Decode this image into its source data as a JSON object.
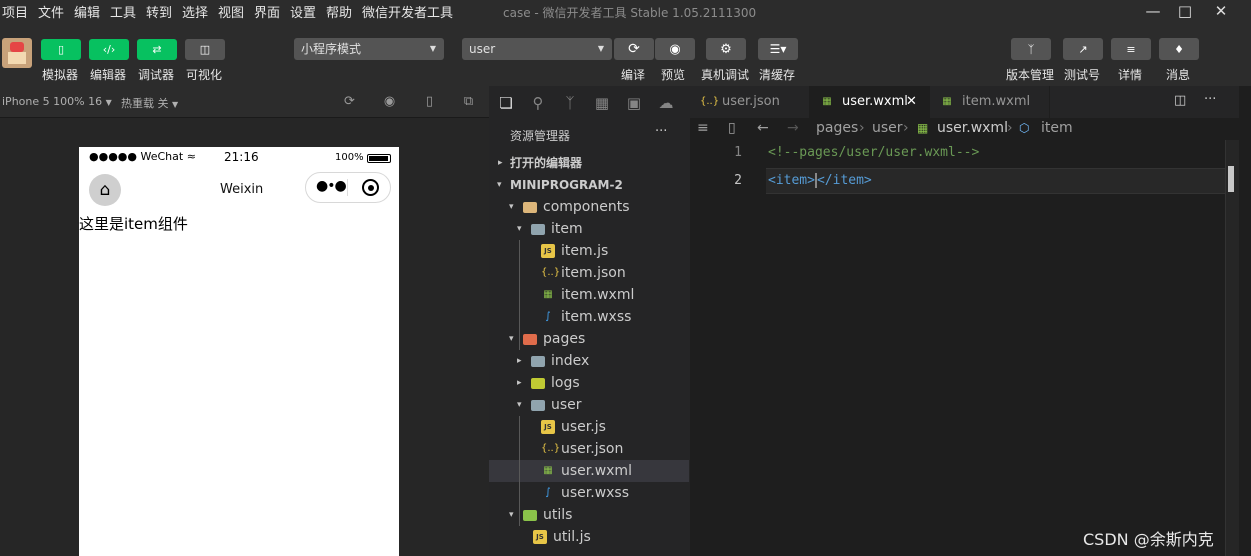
{
  "menu": [
    "项目",
    "文件",
    "编辑",
    "工具",
    "转到",
    "选择",
    "视图",
    "界面",
    "设置",
    "帮助",
    "微信开发者工具"
  ],
  "window_title": "case - 微信开发者工具 Stable 1.05.2111300",
  "toolbar": {
    "left_buttons": [
      {
        "label": "模拟器",
        "icon": "phone-icon"
      },
      {
        "label": "编辑器",
        "icon": "code-icon"
      },
      {
        "label": "调试器",
        "icon": "debug-icon"
      },
      {
        "label": "可视化",
        "icon": "layout-icon"
      }
    ],
    "mode_select": "小程序模式",
    "page_select": "user",
    "compile_label": "编译",
    "preview_label": "预览",
    "real_debug_label": "真机调试",
    "clear_cache_label": "清缓存",
    "right_buttons": [
      {
        "label": "版本管理",
        "icon": "branch-icon"
      },
      {
        "label": "测试号",
        "icon": "external-link-icon"
      },
      {
        "label": "详情",
        "icon": "menu-icon"
      },
      {
        "label": "消息",
        "icon": "bell-icon"
      }
    ]
  },
  "simulator": {
    "device_label": "iPhone 5 100% 16",
    "hot_reload_label": "热重载 关",
    "status_carrier": "●●●●● WeChat",
    "status_time": "21:16",
    "status_battery": "100%",
    "nav_title": "Weixin",
    "content_text": "这里是item组件"
  },
  "explorer": {
    "title": "资源管理器",
    "open_editors": "打开的编辑器",
    "project": "MINIPROGRAM-2",
    "tree": [
      {
        "name": "components",
        "kind": "folder",
        "depth": 0,
        "open": true,
        "icon_color": "#dcb67a"
      },
      {
        "name": "item",
        "kind": "folder",
        "depth": 1,
        "open": true,
        "icon_color": "#90a4ae"
      },
      {
        "name": "item.js",
        "kind": "js",
        "depth": 2
      },
      {
        "name": "item.json",
        "kind": "json",
        "depth": 2
      },
      {
        "name": "item.wxml",
        "kind": "wxml",
        "depth": 2
      },
      {
        "name": "item.wxss",
        "kind": "wxss",
        "depth": 2
      },
      {
        "name": "pages",
        "kind": "folder",
        "depth": 0,
        "open": true,
        "icon_color": "#e06c4b"
      },
      {
        "name": "index",
        "kind": "folder",
        "depth": 1,
        "open": false,
        "icon_color": "#90a4ae"
      },
      {
        "name": "logs",
        "kind": "folder",
        "depth": 1,
        "open": false,
        "icon_color": "#c0ca33"
      },
      {
        "name": "user",
        "kind": "folder",
        "depth": 1,
        "open": true,
        "icon_color": "#90a4ae"
      },
      {
        "name": "user.js",
        "kind": "js",
        "depth": 2
      },
      {
        "name": "user.json",
        "kind": "json",
        "depth": 2
      },
      {
        "name": "user.wxml",
        "kind": "wxml",
        "depth": 2,
        "selected": true
      },
      {
        "name": "user.wxss",
        "kind": "wxss",
        "depth": 2
      },
      {
        "name": "utils",
        "kind": "folder",
        "depth": 0,
        "open": true,
        "icon_color": "#8bc34a"
      },
      {
        "name": "util.js",
        "kind": "js",
        "depth": 1
      }
    ]
  },
  "tabs": [
    {
      "label": "user.json",
      "kind": "json",
      "active": false
    },
    {
      "label": "user.wxml",
      "kind": "wxml",
      "active": true
    },
    {
      "label": "item.wxml",
      "kind": "wxml",
      "active": false
    }
  ],
  "breadcrumb": [
    "pages",
    "user",
    "user.wxml",
    "item"
  ],
  "editor": {
    "lines": [
      {
        "num": "1",
        "text": "<!--pages/user/user.wxml-->"
      },
      {
        "num": "2",
        "open_tag": "<item>",
        "close_tag": "</item>"
      }
    ]
  },
  "colors": {
    "accent_green": "#07c160",
    "comment": "#6a9955",
    "tag": "#569cd6"
  },
  "watermark": "CSDN @余斯内克"
}
